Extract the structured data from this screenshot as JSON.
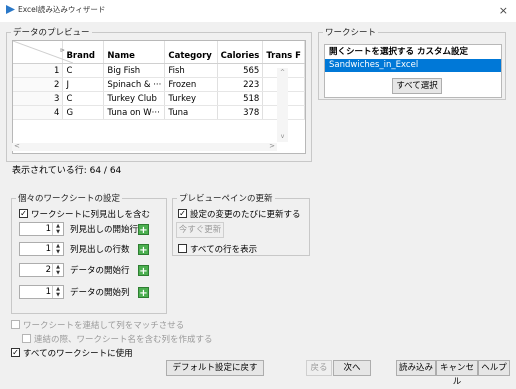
{
  "window": {
    "title": "Excel読み込みウィザード",
    "close": "×"
  },
  "preview": {
    "legend": "データのプレビュー",
    "columns": [
      "Brand",
      "Name",
      "Category",
      "Calories",
      "Trans F"
    ],
    "rows": [
      {
        "n": "1",
        "cells": [
          "C",
          "Big Fish",
          "Fish",
          "565"
        ]
      },
      {
        "n": "2",
        "cells": [
          "J",
          "Spinach & ···",
          "Frozen",
          "223"
        ]
      },
      {
        "n": "3",
        "cells": [
          "C",
          "Turkey Club",
          "Turkey",
          "518"
        ]
      },
      {
        "n": "4",
        "cells": [
          "G",
          "Tuna on W···",
          "Tuna",
          "378"
        ]
      }
    ]
  },
  "status": {
    "rows_shown": "表示されている行: 64 / 64"
  },
  "worksheet": {
    "legend": "ワークシート",
    "header": "開くシートを選択する  カスタム設定",
    "selected": "Sandwiches_in_Excel",
    "select_all": "すべて選択"
  },
  "individual": {
    "legend": "個々のワークシートの設定",
    "include_headers": "ワークシートに列見出しを含む",
    "header_start_row": {
      "value": "1",
      "label": "列見出しの開始行"
    },
    "header_row_count": {
      "value": "1",
      "label": "列見出しの行数"
    },
    "data_start_row": {
      "value": "2",
      "label": "データの開始行"
    },
    "data_start_col": {
      "value": "1",
      "label": "データの開始列"
    }
  },
  "preview_update": {
    "legend": "プレビューペインの更新",
    "update_on_change": "設定の変更のたびに更新する",
    "update_now": "今すぐ更新",
    "show_all_rows": "すべての行を表示"
  },
  "options": {
    "concat_match": "ワークシートを連結して列をマッチさせる",
    "create_name_col": "連結の際、ワークシート名を含む列を作成する",
    "use_all": "すべてのワークシートに使用"
  },
  "footer": {
    "restore_defaults": "デフォルト設定に戻す",
    "back": "戻る",
    "next": "次へ",
    "import": "読み込み",
    "cancel": "キャンセル",
    "help": "ヘルプ"
  }
}
